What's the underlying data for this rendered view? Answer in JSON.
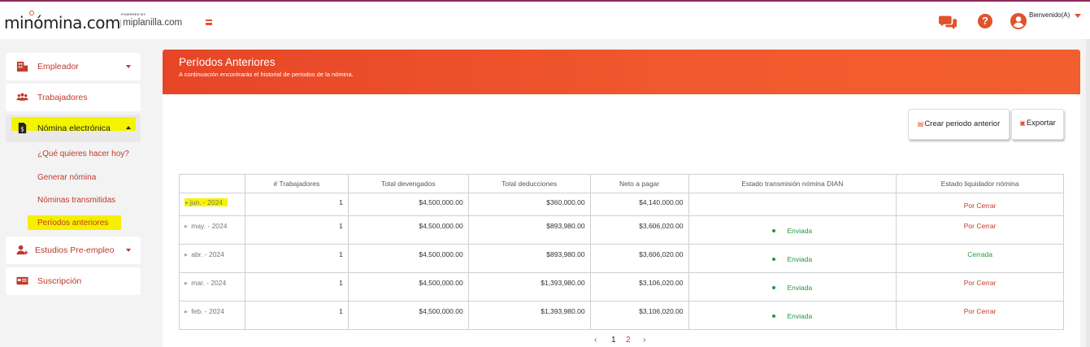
{
  "header": {
    "logo": "minómina.com",
    "powered_by": "POWERED BY",
    "partner": "miplanilla.com",
    "user_greeting": "Bienvenido(A)",
    "icons": [
      "menu-icon",
      "chat-icon",
      "help-icon",
      "user-icon"
    ],
    "help_glyph": "?"
  },
  "sidebar": {
    "items": [
      {
        "label": "Empleador",
        "icon": "building-icon"
      },
      {
        "label": "Trabajadores",
        "icon": "users-icon"
      },
      {
        "label": "Nómina electrónica",
        "icon": "payroll-file-icon"
      },
      {
        "label": "Estudios Pre-empleo",
        "icon": "user-add-icon"
      },
      {
        "label": "Suscripción",
        "icon": "card-icon"
      }
    ],
    "sub_items": [
      "¿Qué quieres hacer hoy?",
      "Generar nómina",
      "Nóminas transmitidas",
      "Períodos anteriores"
    ]
  },
  "page": {
    "title": "Períodos Anteriores",
    "subtitle": "A continuación encontrarás el historial de periodos de la nómina.",
    "create_button": "Crear periodo anterior",
    "export_button": "Exportar"
  },
  "table": {
    "headers": [
      "",
      "# Trabajadores",
      "Total devengados",
      "Total deducciones",
      "Neto a pagar",
      "Estado transmisión nómina DIAN",
      "Estado liquidador nómina"
    ],
    "rows": [
      {
        "period": "jun. - 2024",
        "workers": "1",
        "earned": "$4,500,000.00",
        "deductions": "$360,000.00",
        "net": "$4,140,000.00",
        "dian": "",
        "liquidator": "Por Cerrar"
      },
      {
        "period": "may. - 2024",
        "workers": "1",
        "earned": "$4,500,000.00",
        "deductions": "$893,980.00",
        "net": "$3,606,020.00",
        "dian": "Enviada",
        "liquidator": "Por Cerrar"
      },
      {
        "period": "abr. - 2024",
        "workers": "1",
        "earned": "$4,500,000.00",
        "deductions": "$893,980.00",
        "net": "$3,606,020.00",
        "dian": "Enviada",
        "liquidator": "Cerrada"
      },
      {
        "period": "mar. - 2024",
        "workers": "1",
        "earned": "$4,500,000.00",
        "deductions": "$1,393,980.00",
        "net": "$3,106,020.00",
        "dian": "Enviada",
        "liquidator": "Por Cerrar"
      },
      {
        "period": "feb. - 2024",
        "workers": "1",
        "earned": "$4,500,000.00",
        "deductions": "$1,393,980.00",
        "net": "$3,106,020.00",
        "dian": "Enviada",
        "liquidator": "Por Cerrar"
      }
    ]
  },
  "pagination": {
    "prev": "‹",
    "pages": [
      "1",
      "2"
    ],
    "next": "›"
  },
  "colors": {
    "accent": "#e0532b",
    "banner": "#f15a2e",
    "success": "#1f9a3a",
    "danger": "#c0392b",
    "highlight": "#f6f400"
  }
}
